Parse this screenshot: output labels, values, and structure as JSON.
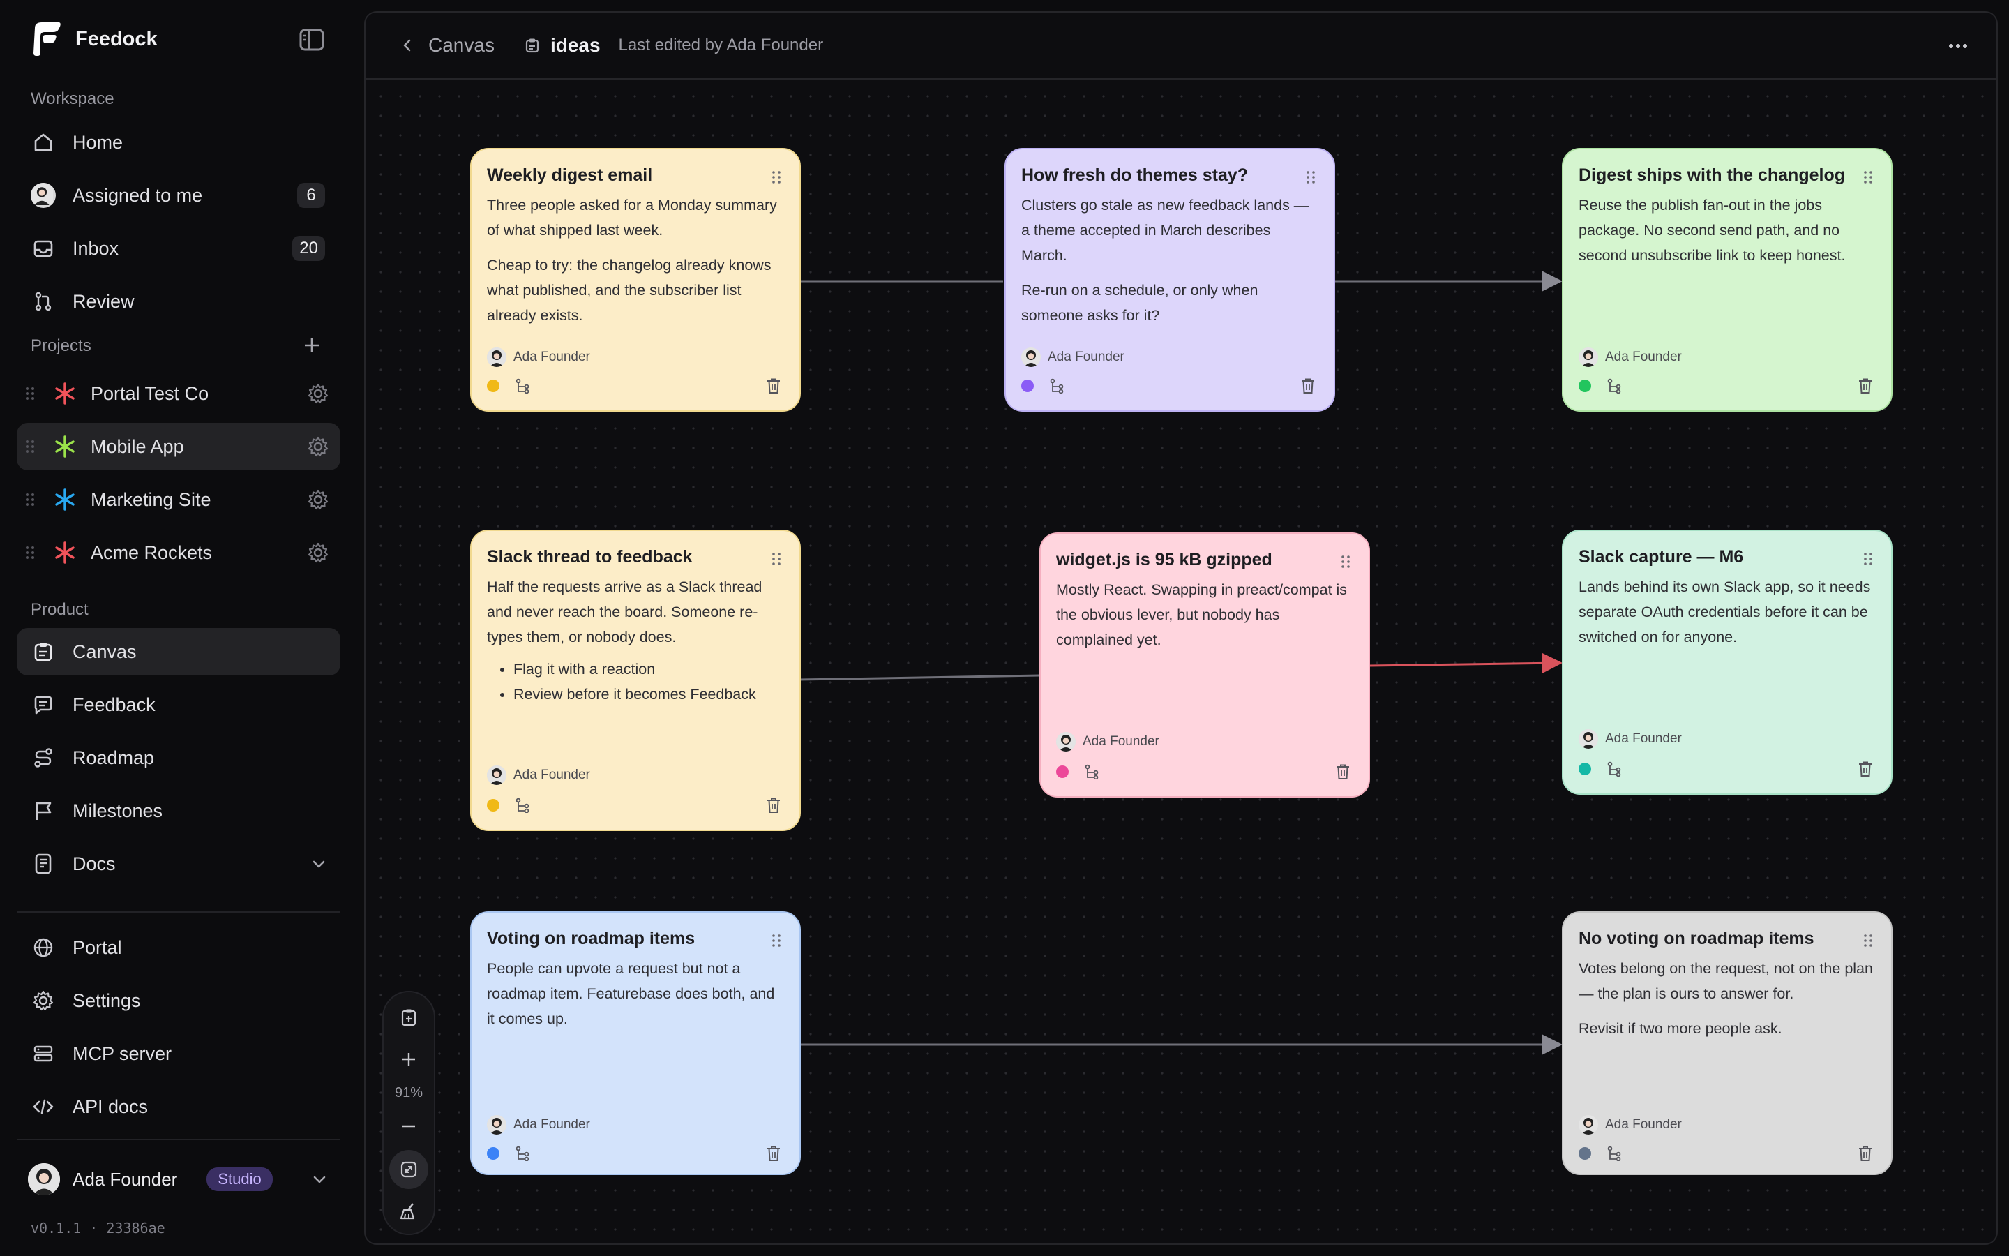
{
  "brand": {
    "name": "Feedock"
  },
  "sidebar": {
    "workspace_label": "Workspace",
    "workspace_items": [
      {
        "label": "Home",
        "icon": "home-icon"
      },
      {
        "label": "Assigned to me",
        "icon": "avatar",
        "count": "6"
      },
      {
        "label": "Inbox",
        "icon": "inbox-icon",
        "count": "20"
      },
      {
        "label": "Review",
        "icon": "git-pull-request-icon"
      }
    ],
    "projects_label": "Projects",
    "projects": [
      {
        "label": "Portal Test Co",
        "color": "#f2545b"
      },
      {
        "label": "Mobile App",
        "color": "#9be34a",
        "active": true
      },
      {
        "label": "Marketing Site",
        "color": "#29a8f0"
      },
      {
        "label": "Acme Rockets",
        "color": "#f2545b"
      }
    ],
    "product_label": "Product",
    "product_items": [
      {
        "label": "Canvas",
        "icon": "canvas-icon",
        "active": true
      },
      {
        "label": "Feedback",
        "icon": "feedback-icon"
      },
      {
        "label": "Roadmap",
        "icon": "roadmap-icon"
      },
      {
        "label": "Milestones",
        "icon": "flag-icon"
      },
      {
        "label": "Docs",
        "icon": "docs-icon"
      }
    ],
    "bottom_items": [
      {
        "label": "Portal",
        "icon": "globe-icon"
      },
      {
        "label": "Settings",
        "icon": "gear-icon"
      },
      {
        "label": "MCP server",
        "icon": "server-icon"
      },
      {
        "label": "API docs",
        "icon": "code-icon"
      }
    ],
    "user": {
      "name": "Ada Founder",
      "plan": "Studio"
    },
    "version": "v0.1.1 · 23386ae"
  },
  "topbar": {
    "breadcrumb": "Canvas",
    "doc_title": "ideas",
    "edited": "Last edited by Ada Founder"
  },
  "toolbar": {
    "zoom": "91%"
  },
  "cards": [
    {
      "id": "c1",
      "color": "yellow",
      "dot": "#f0b917",
      "title": "Weekly digest email",
      "paragraphs": [
        "Three people asked for a Monday summary of what shipped last week.",
        "Cheap to try: the changelog already knows what published, and the subscriber list already exists."
      ],
      "author": "Ada Founder"
    },
    {
      "id": "c2",
      "color": "purple",
      "dot": "#8b5cf6",
      "title": "How fresh do themes stay?",
      "paragraphs": [
        "Clusters go stale as new feedback lands — a theme accepted in March describes March.",
        "Re-run on a schedule, or only when someone asks for it?"
      ],
      "author": "Ada Founder"
    },
    {
      "id": "c3",
      "color": "green",
      "dot": "#22c55e",
      "title": "Digest ships with the changelog",
      "paragraphs": [
        "Reuse the publish fan-out in the jobs package. No second send path, and no second unsubscribe link to keep honest."
      ],
      "author": "Ada Founder"
    },
    {
      "id": "c4",
      "color": "yellow",
      "dot": "#f0b917",
      "title": "Slack thread to feedback",
      "paragraphs": [
        "Half the requests arrive as a Slack thread and never reach the board. Someone re-types them, or nobody does."
      ],
      "bullets": [
        "Flag it with a reaction",
        "Review before it becomes Feedback"
      ],
      "author": "Ada Founder"
    },
    {
      "id": "c5",
      "color": "pink",
      "dot": "#ec4899",
      "title": "widget.js is 95 kB gzipped",
      "paragraphs": [
        "Mostly React. Swapping in preact/compat is the obvious lever, but nobody has complained yet."
      ],
      "author": "Ada Founder"
    },
    {
      "id": "c6",
      "color": "teal",
      "dot": "#14b8a6",
      "title": "Slack capture — M6",
      "paragraphs": [
        "Lands behind its own Slack app, so it needs separate OAuth credentials before it can be switched on for anyone."
      ],
      "author": "Ada Founder"
    },
    {
      "id": "c7",
      "color": "blue",
      "dot": "#3b82f6",
      "title": "Voting on roadmap items",
      "paragraphs": [
        "People can upvote a request but not a roadmap item. Featurebase does both, and it comes up."
      ],
      "author": "Ada Founder"
    },
    {
      "id": "c8",
      "color": "gray",
      "dot": "#64748b",
      "title": "No voting on roadmap items",
      "paragraphs": [
        "Votes belong on the request, not on the plan — the plan is ours to answer for.",
        "Revisit if two more people ask."
      ],
      "author": "Ada Founder"
    }
  ]
}
